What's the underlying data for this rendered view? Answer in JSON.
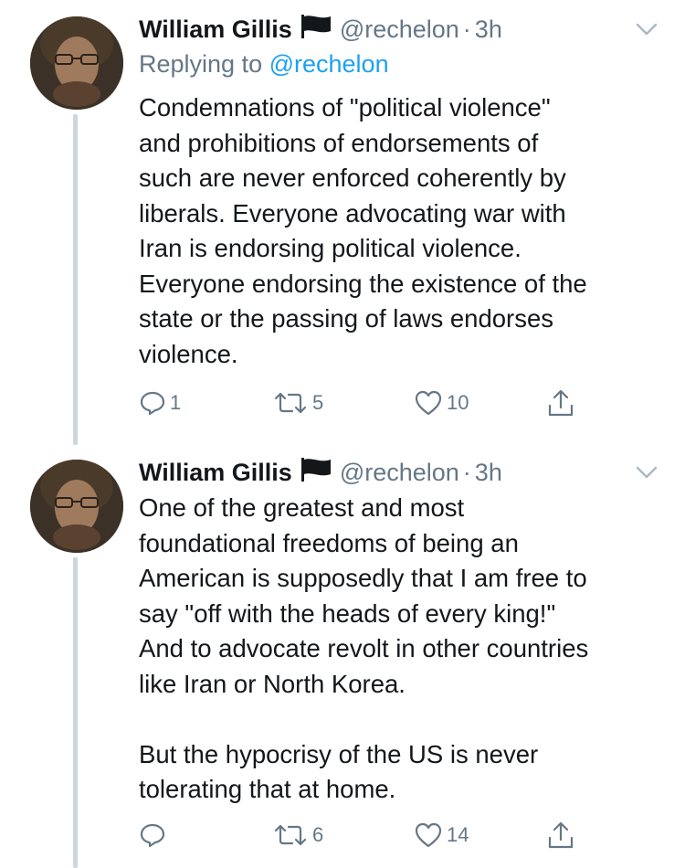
{
  "thread": [
    {
      "author": {
        "name": "William Gillis",
        "handle": "@rechelon",
        "separator": "·",
        "time": "3h"
      },
      "replying": {
        "prefix": "Replying to",
        "mention": "@rechelon"
      },
      "body": "Condemnations of \"political violence\"\nand prohibitions of endorsements of\nsuch are never enforced coherently by\nliberals. Everyone advocating war with\nIran is endorsing political violence.\nEveryone endorsing the existence of the\nstate or the passing of laws endorses\nviolence.",
      "actions": {
        "replies": "1",
        "retweets": "5",
        "likes": "10"
      }
    },
    {
      "author": {
        "name": "William Gillis",
        "handle": "@rechelon",
        "separator": "·",
        "time": "3h"
      },
      "body": "One of the greatest and most\nfoundational freedoms of being an\nAmerican is supposedly that I am free to\nsay \"off with the heads of every king!\"\nAnd to advocate revolt in other countries\nlike Iran or North Korea.\n\nBut the hypocrisy of the US is never\ntolerating that at home.",
      "actions": {
        "replies": "",
        "retweets": "6",
        "likes": "14"
      }
    }
  ],
  "icons": {
    "flag": "black-flag-icon",
    "caret": "chevron-down-icon",
    "reply": "reply-icon",
    "retweet": "retweet-icon",
    "like": "heart-icon",
    "share": "share-icon"
  },
  "colors": {
    "link": "#1da1f2",
    "secondary": "#657786",
    "thread_line": "#ccd6dd",
    "text": "#14171a"
  }
}
